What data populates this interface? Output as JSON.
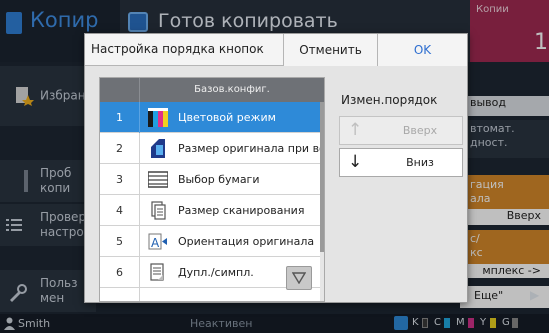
{
  "background": {
    "app_title": "Копир",
    "status_text": "Готов копировать",
    "copies_label": "Копии",
    "copies_value": "1",
    "sidebar": [
      {
        "label": "Избран"
      },
      {
        "label": "Проб копи"
      },
      {
        "label": "Провер настро"
      },
      {
        "label": "Польз мен"
      }
    ],
    "right": {
      "item1": "вывод",
      "item2_a": "втомат.",
      "item2_b": "дност.",
      "item3_a": "гация",
      "item3_b": "ала",
      "item3_c": "Вверх",
      "item4_a": "с/",
      "item4_b": "кс",
      "item4_c": "мплекс ->",
      "more": "Еще\""
    },
    "footer": {
      "user": "Smith",
      "status": "Неактивен",
      "inks": [
        "K",
        "C",
        "M",
        "Y",
        "G"
      ]
    },
    "colors": {
      "accent_blue": "#2e8ad8",
      "copies_bg": "#a02a52",
      "orange_strip": "#d4892a"
    }
  },
  "dialog": {
    "title": "Настройка порядка кнопок",
    "cancel_label": "Отменить",
    "ok_label": "OK",
    "list_header": "Базов.конфиг.",
    "rows": [
      {
        "num": "1",
        "label": "Цветовой режим",
        "icon": "color-mode-icon"
      },
      {
        "num": "2",
        "label": "Размер оригинала при вос",
        "icon": "original-size-icon"
      },
      {
        "num": "3",
        "label": "Выбор бумаги",
        "icon": "paper-tray-icon"
      },
      {
        "num": "4",
        "label": "Размер сканирования",
        "icon": "scan-size-icon"
      },
      {
        "num": "5",
        "label": "Ориентация оригинала",
        "icon": "orientation-icon"
      },
      {
        "num": "6",
        "label": "Дупл./симпл.",
        "icon": "duplex-icon"
      }
    ],
    "order_label": "Измен.порядок",
    "up_label": "Вверх",
    "down_label": "Вниз"
  }
}
